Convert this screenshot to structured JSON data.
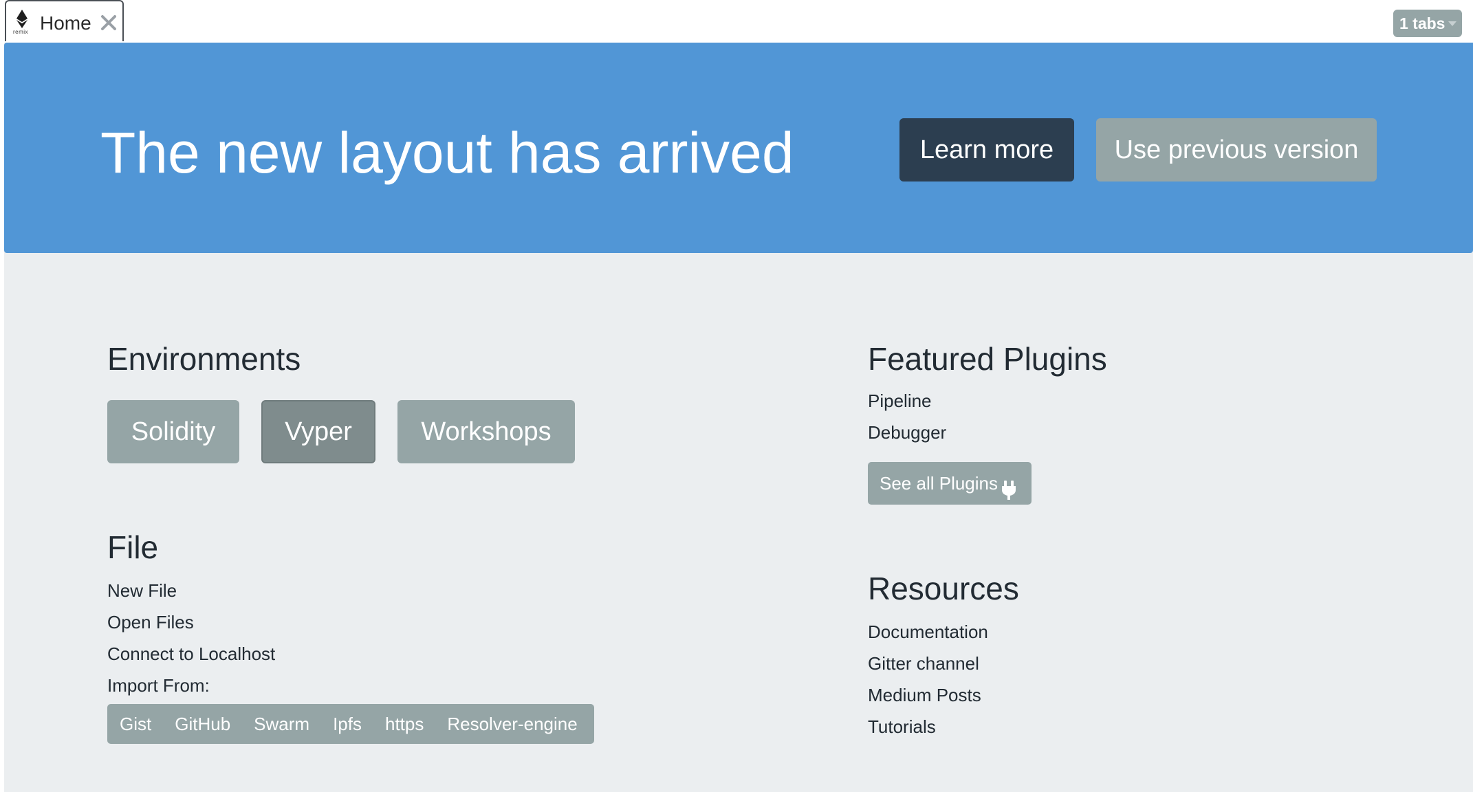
{
  "tabbar": {
    "tab": {
      "label": "Home",
      "logo_caption": "remix"
    },
    "tabs_counter": "1 tabs"
  },
  "banner": {
    "title": "The new layout has arrived",
    "learn_more": "Learn more",
    "use_previous": "Use previous version",
    "color": "#5196d6"
  },
  "environments": {
    "title": "Environments",
    "buttons": [
      "Solidity",
      "Vyper",
      "Workshops"
    ],
    "active": "Vyper"
  },
  "file": {
    "title": "File",
    "links": [
      "New File",
      "Open Files",
      "Connect to Localhost"
    ],
    "import_label": "Import From:",
    "import_sources": [
      "Gist",
      "GitHub",
      "Swarm",
      "Ipfs",
      "https",
      "Resolver-engine"
    ]
  },
  "featured_plugins": {
    "title": "Featured Plugins",
    "items": [
      "Pipeline",
      "Debugger"
    ],
    "see_all": "See all Plugins"
  },
  "resources": {
    "title": "Resources",
    "links": [
      "Documentation",
      "Gitter channel",
      "Medium Posts",
      "Tutorials"
    ]
  },
  "icons": {
    "logo": "ethereum-diamond-icon",
    "close": "close-icon",
    "caret": "caret-down-icon",
    "plugin": "plug-icon"
  },
  "colors": {
    "dark_button": "#2c3e50",
    "secondary_button": "#95a5a6",
    "page_background": "#ebeef0"
  }
}
